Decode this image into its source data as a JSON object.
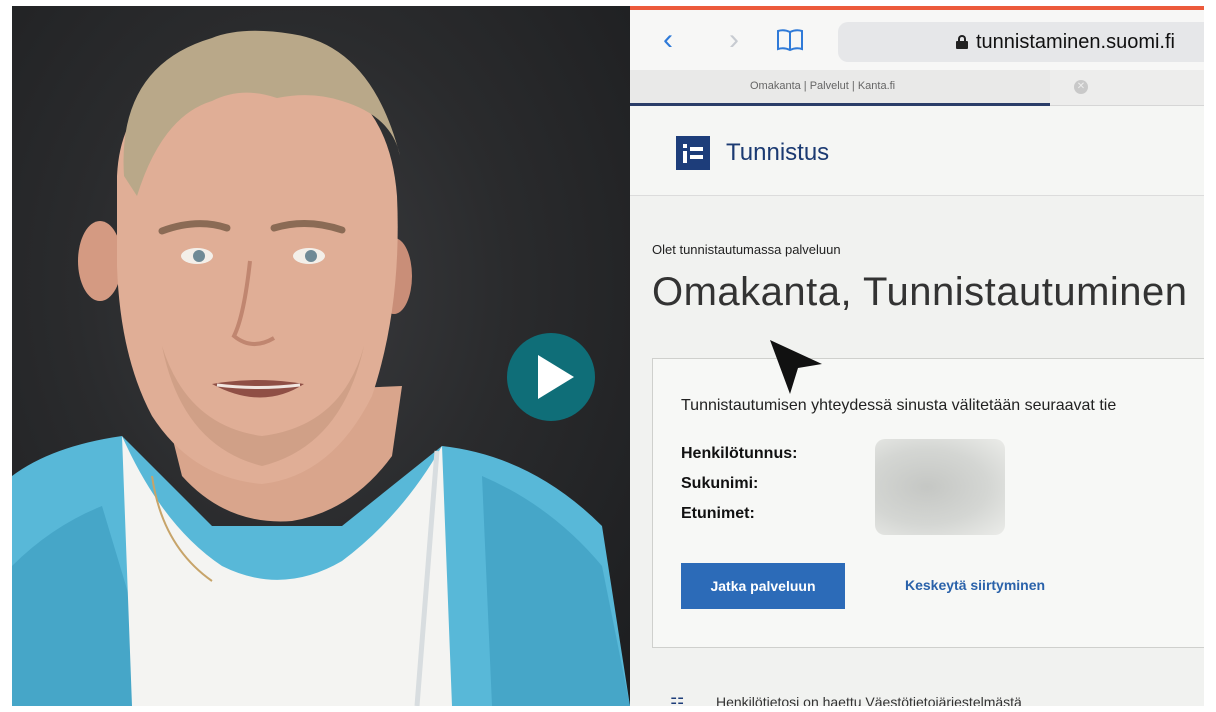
{
  "player": {
    "play_icon": "play-icon",
    "play_color": "#0f6e78"
  },
  "browser": {
    "accent_color": "#ec5a3c",
    "back_icon": "chevron-left-icon",
    "forward_icon": "chevron-right-icon",
    "bookmarks_icon": "book-icon",
    "address": "tunnistaminen.suomi.fi",
    "tab_title": "Omakanta | Palvelut | Kanta.fi",
    "tab_close_icon": "close-icon"
  },
  "site": {
    "logo_icon": "suomi-fi-logo-icon",
    "service_name": "Tunnistus",
    "intro_label": "Olet tunnistautumassa palveluun",
    "page_title": "Omakanta, Tunnistautuminen",
    "info_box": {
      "intro": "Tunnistautumisen yhteydessä sinusta välitetään seuraavat tie",
      "fields": [
        {
          "label": "Henkilötunnus:"
        },
        {
          "label": "Sukunimi:"
        },
        {
          "label": "Etunimet:"
        }
      ]
    },
    "continue_label": "Jatka palveluun",
    "cancel_label": "Keskeytä siirtyminen",
    "footer_text": "Henkilötietosi on haettu Väestötietojärjestelmästä",
    "brand_color": "#1d3d7a"
  }
}
